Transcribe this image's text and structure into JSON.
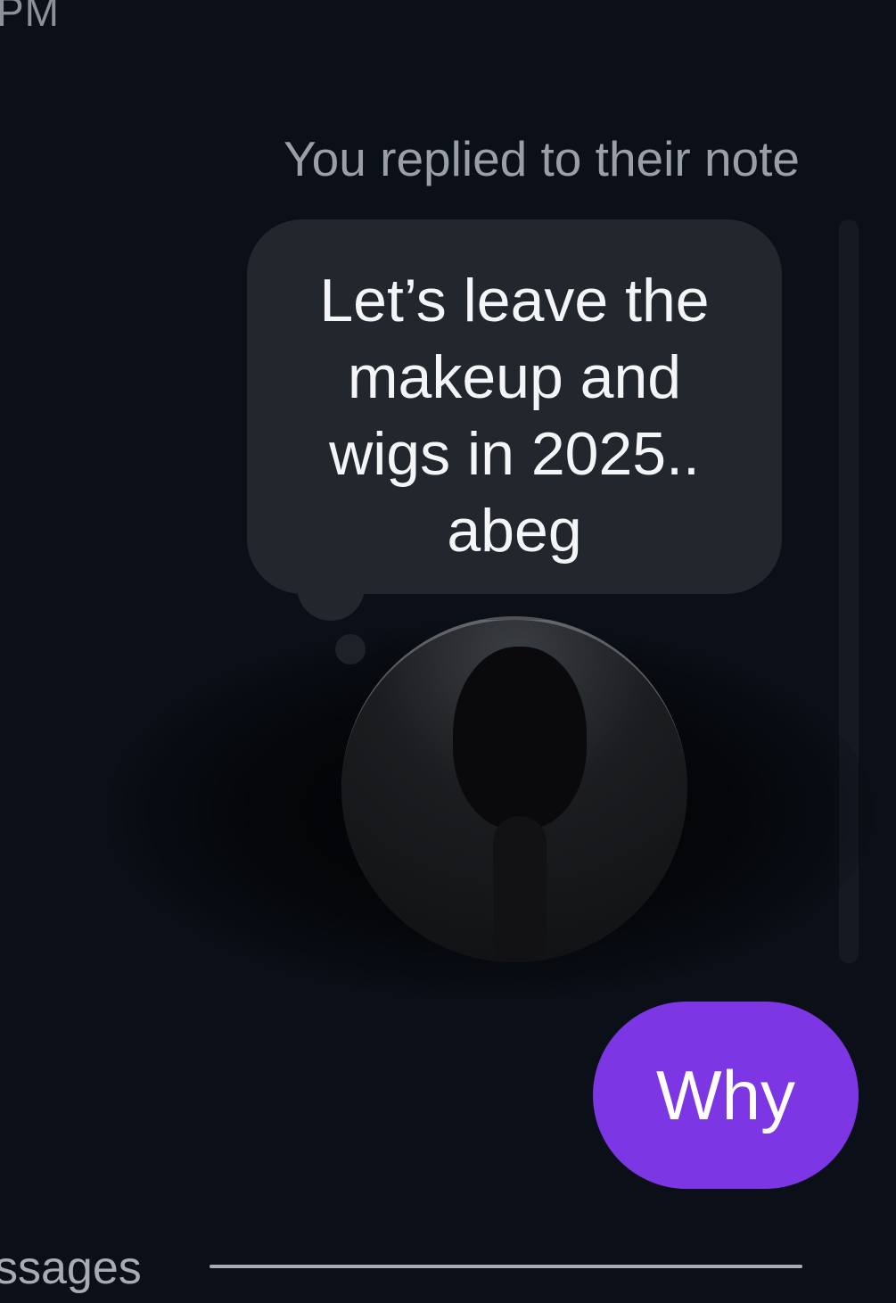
{
  "header": {
    "timestamp": "PM"
  },
  "conversation": {
    "reply_context": "You replied to their note",
    "note_text": "Let’s leave the makeup and wigs in 2025.. abeg",
    "reply_text": "Why",
    "reply_bubble_color": "#7d36e3"
  },
  "footer": {
    "label": "ssages"
  }
}
